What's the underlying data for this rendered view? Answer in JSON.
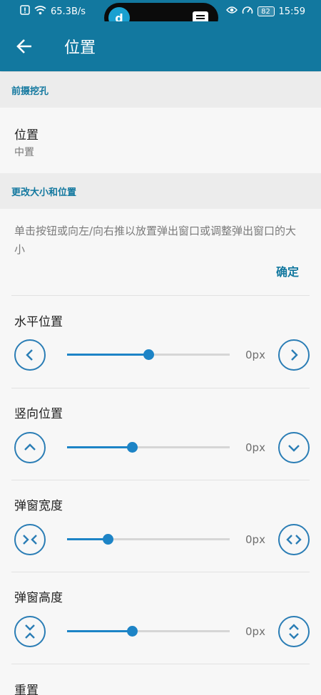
{
  "status_bar": {
    "net_speed": "65.3B/s",
    "battery": "82",
    "time": "15:59",
    "island_app_letter": "d",
    "icons": [
      "alert-icon",
      "wifi-icon",
      "eye-icon",
      "speedometer-icon",
      "battery-icon",
      "message-icon"
    ]
  },
  "app_bar": {
    "title": "位置",
    "back_icon": "arrow-left-icon"
  },
  "section_front_camera": {
    "header": "前摄挖孔",
    "position_title": "位置",
    "position_value": "中置"
  },
  "section_resize": {
    "header": "更改大小和位置",
    "description": "单击按钮或向左/向右推以放置弹出窗口或调整弹出窗口的大小",
    "ok_label": "确定"
  },
  "controls": [
    {
      "title": "水平位置",
      "value_text": "0px",
      "level": 0.5,
      "left_icon": "chevron-left-icon",
      "right_icon": "chevron-right-icon"
    },
    {
      "title": "竖向位置",
      "value_text": "0px",
      "level": 0.4,
      "left_icon": "chevron-up-icon",
      "right_icon": "chevron-down-icon"
    },
    {
      "title": "弹窗宽度",
      "value_text": "0px",
      "level": 0.25,
      "left_icon": "shrink-horizontal-icon",
      "right_icon": "expand-horizontal-icon"
    },
    {
      "title": "弹窗高度",
      "value_text": "0px",
      "level": 0.4,
      "left_icon": "shrink-vertical-icon",
      "right_icon": "expand-vertical-icon"
    }
  ],
  "reset_label": "重置",
  "colors": {
    "primary": "#12789f",
    "accent": "#1d84c6",
    "section_bg": "#ececec"
  }
}
